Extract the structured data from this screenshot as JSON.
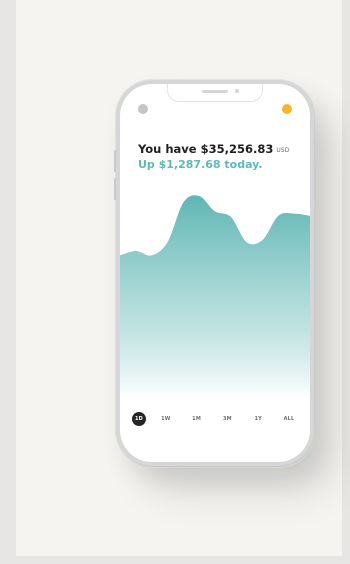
{
  "header": {
    "balance_prefix": "You have",
    "balance_amount": "$35,256.83",
    "currency": "USD",
    "change_text": "Up $1,287.68 today."
  },
  "colors": {
    "accent": "#5fb9b7",
    "badge": "#f7b52c",
    "chart_top": "#5eb6b4",
    "chart_bottom": "#ffffff"
  },
  "periods": {
    "items": [
      {
        "label": "1D",
        "active": true
      },
      {
        "label": "1W",
        "active": false
      },
      {
        "label": "1M",
        "active": false
      },
      {
        "label": "3M",
        "active": false
      },
      {
        "label": "1Y",
        "active": false
      },
      {
        "label": "ALL",
        "active": false
      }
    ]
  },
  "chart_data": {
    "type": "area",
    "x": [
      0,
      1,
      2,
      3,
      4,
      5,
      6,
      7,
      8,
      9,
      10,
      11,
      12
    ],
    "series": [
      {
        "values": [
          46,
          50,
          46,
          58,
          94,
          100,
          86,
          81,
          58,
          60,
          82,
          84,
          82
        ]
      }
    ],
    "grid": false
  }
}
